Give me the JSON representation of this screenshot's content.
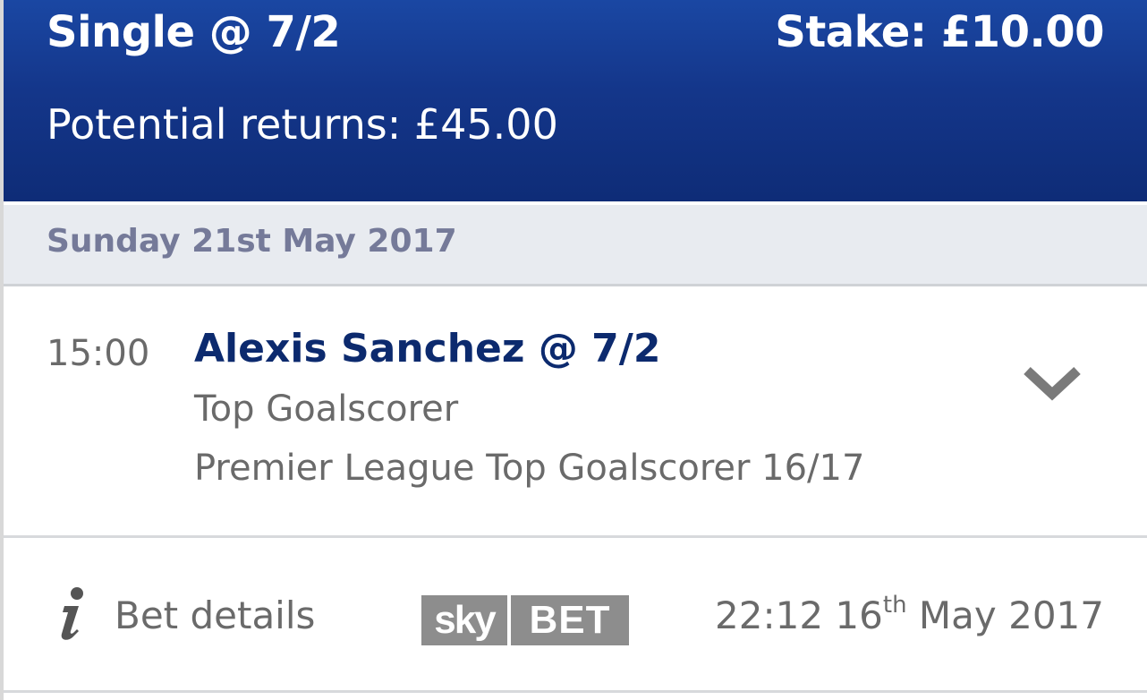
{
  "header": {
    "bet_type": "Single @ 7/2",
    "stake": "Stake: £10.00",
    "potential_returns": "Potential returns: £45.00"
  },
  "date_section": {
    "date": "Sunday 21st May 2017"
  },
  "selection": {
    "time": "15:00",
    "title": "Alexis Sanchez @ 7/2",
    "market": "Top Goalscorer",
    "event": "Premier League Top Goalscorer 16/17",
    "expand_icon": "chevron-down-icon"
  },
  "footer": {
    "info_icon": "info-icon",
    "bet_details_label": "Bet details",
    "logo": {
      "sky": "sky",
      "bet": "BET"
    },
    "placed_time": "22:12 16",
    "placed_ordinal": "th",
    "placed_rest": " May 2017"
  },
  "colors": {
    "header_blue": "#14368a",
    "title_navy": "#0c2a6e",
    "date_text": "#757a99",
    "date_bg": "#e8ebf0",
    "grey_text": "#6a6a6a",
    "logo_grey": "#8d8d8d"
  }
}
